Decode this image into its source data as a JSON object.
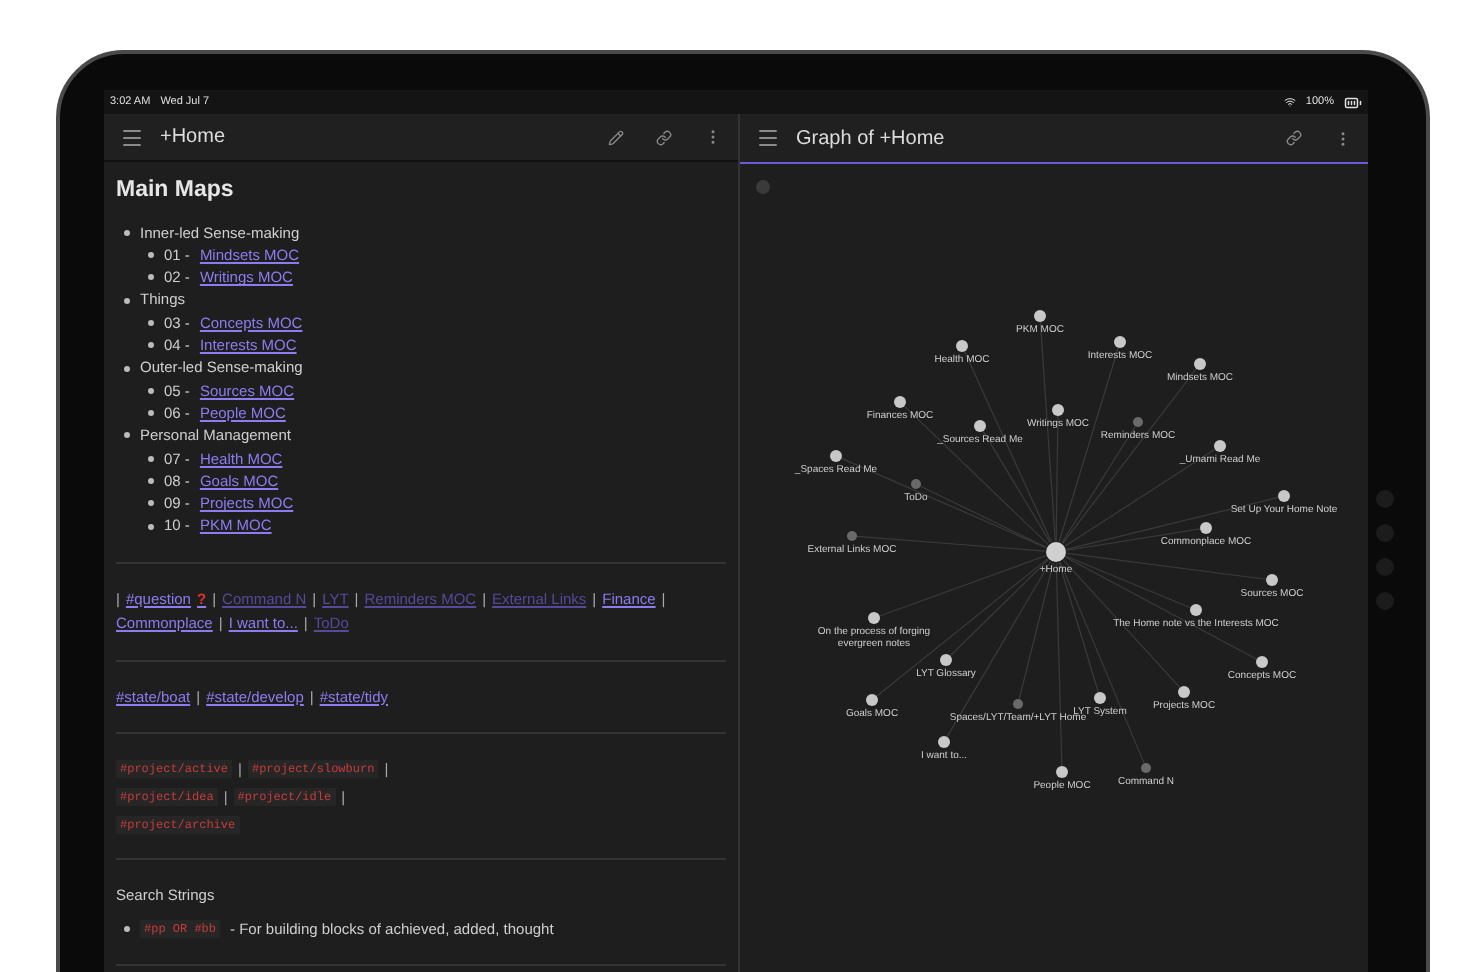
{
  "status_bar": {
    "time": "3:02 AM",
    "date": "Wed Jul 7",
    "battery": "100%"
  },
  "left_pane": {
    "title": "+Home",
    "active": false,
    "heading": "Main Maps",
    "outline": [
      {
        "text": "Inner-led Sense-making",
        "children": [
          {
            "prefix": "01 -",
            "link": "Mindsets MOC"
          },
          {
            "prefix": "02 -",
            "link": "Writings MOC"
          }
        ]
      },
      {
        "text": "Things",
        "children": [
          {
            "prefix": "03 -",
            "link": "Concepts MOC"
          },
          {
            "prefix": "04 -",
            "link": "Interests MOC"
          }
        ]
      },
      {
        "text": "Outer-led Sense-making",
        "children": [
          {
            "prefix": "05 -",
            "link": "Sources MOC"
          },
          {
            "prefix": "06 -",
            "link": "People MOC"
          }
        ]
      },
      {
        "text": "Personal Management",
        "children": [
          {
            "prefix": "07 -",
            "link": "Health MOC"
          },
          {
            "prefix": "08 -",
            "link": "Goals MOC"
          },
          {
            "prefix": "09 -",
            "link": "Projects MOC"
          },
          {
            "prefix": "10 -",
            "link": "PKM MOC"
          }
        ]
      }
    ],
    "link_bar": {
      "separator": "|",
      "leading_separator": true,
      "links": [
        {
          "text": "#question",
          "badge": "?",
          "resolved": true
        },
        {
          "text": "Command N",
          "resolved": false
        },
        {
          "text": "LYT",
          "resolved": false
        },
        {
          "text": "Reminders MOC",
          "resolved": false
        },
        {
          "text": "External Links",
          "resolved": false
        },
        {
          "text": "Finance",
          "resolved": true
        },
        {
          "text": "Commonplace",
          "resolved": true
        },
        {
          "text": "I want to...",
          "resolved": true
        },
        {
          "text": "ToDo",
          "resolved": false
        }
      ]
    },
    "state_tags": {
      "separator": "|",
      "tags": [
        "#state/boat",
        "#state/develop",
        "#state/tidy"
      ]
    },
    "project_tags": {
      "separator": "|",
      "tags": [
        "#project/active",
        "#project/slowburn",
        "#project/idea",
        "#project/idle",
        "#project/archive"
      ]
    },
    "search_strings": {
      "heading": "Search Strings",
      "items": [
        {
          "code": "#pp OR #bb",
          "text": "- For building blocks of achieved, added, thought"
        }
      ]
    }
  },
  "graph_pane": {
    "title": "Graph of +Home",
    "active": true,
    "center": {
      "label": "+Home"
    },
    "nodes": [
      {
        "label": "PKM MOC",
        "resolved": true
      },
      {
        "label": "Health MOC",
        "resolved": true
      },
      {
        "label": "Interests MOC",
        "resolved": true
      },
      {
        "label": "Mindsets MOC",
        "resolved": true
      },
      {
        "label": "Finances MOC",
        "resolved": true
      },
      {
        "label": "Writings MOC",
        "resolved": true
      },
      {
        "label": "Reminders MOC",
        "resolved": false
      },
      {
        "label": "_Sources Read Me",
        "resolved": true
      },
      {
        "label": "_Spaces Read Me",
        "resolved": true
      },
      {
        "label": "_Umami Read Me",
        "resolved": true
      },
      {
        "label": "ToDo",
        "resolved": false
      },
      {
        "label": "Set Up Your Home Note",
        "resolved": true
      },
      {
        "label": "Commonplace MOC",
        "resolved": true
      },
      {
        "label": "External Links MOC",
        "resolved": false
      },
      {
        "label": "Sources MOC",
        "resolved": true
      },
      {
        "label": "The Home note vs the Interests MOC",
        "resolved": true
      },
      {
        "label": "On the process of forging evergreen notes",
        "resolved": true
      },
      {
        "label": "LYT Glossary",
        "resolved": true
      },
      {
        "label": "Concepts MOC",
        "resolved": true
      },
      {
        "label": "Goals MOC",
        "resolved": true
      },
      {
        "label": "Projects MOC",
        "resolved": true
      },
      {
        "label": "Spaces/LYT/Team/+LYT Home",
        "resolved": false
      },
      {
        "label": "LYT System",
        "resolved": true
      },
      {
        "label": "I want to...",
        "resolved": true
      },
      {
        "label": "People MOC",
        "resolved": true
      },
      {
        "label": "Command N",
        "resolved": false
      }
    ]
  }
}
